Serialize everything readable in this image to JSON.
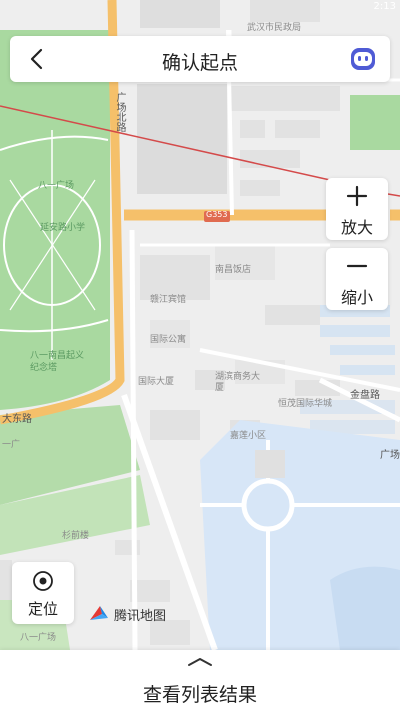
{
  "status_bar": {
    "time": "2:13"
  },
  "header": {
    "title": "确认起点",
    "back_icon": "chevron-left-icon",
    "assistant_icon": "robot-face-icon",
    "accent": "#3d5afe"
  },
  "controls": {
    "zoom_in_label": "放大",
    "zoom_out_label": "缩小",
    "locate_label": "定位"
  },
  "brand": {
    "name": "腾讯地图"
  },
  "map_labels": {
    "top_label": "武汉市民政局",
    "road_guangchang_north": "广场北路",
    "road_badge": "G353",
    "park_1": "八一广场",
    "park_2": "延安路小学",
    "park_3": "八一南昌起义纪念塔",
    "road_dongjie": "大东路",
    "road_yiguang": "一广",
    "bld_1": "南昌饭店",
    "bld_2": "赣江宾馆",
    "bld_3": "国际公寓",
    "bld_4": "国际大厦",
    "bld_5": "湖滨商务大厦",
    "road_jinpan": "金盘路",
    "bld_6": "恒茂国际华城",
    "bld_7": "嘉莲小区",
    "road_guang": "广场",
    "district_1": "杉前楼",
    "district_2": "八一广场"
  },
  "bottom_sheet": {
    "label": "查看列表结果"
  }
}
